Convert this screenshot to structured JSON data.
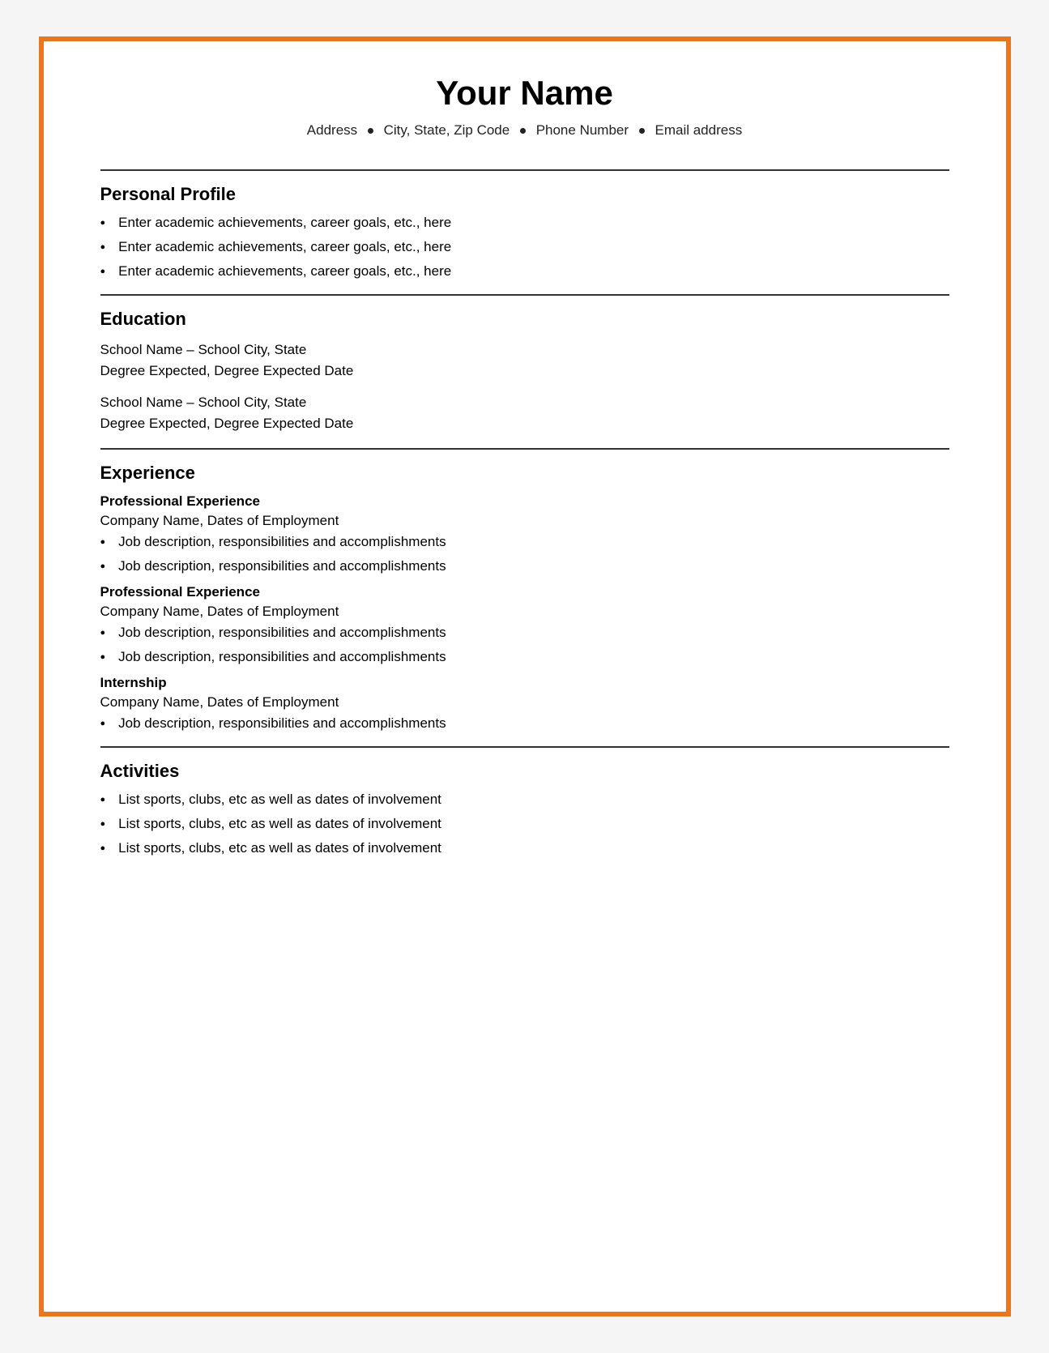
{
  "header": {
    "name": "Your Name",
    "address": "Address",
    "city": "City, State, Zip Code",
    "phone": "Phone Number",
    "email": "Email address"
  },
  "sections": {
    "personal_profile": {
      "title": "Personal Profile",
      "bullets": [
        "Enter academic achievements, career goals, etc., here",
        "Enter academic achievements, career goals, etc., here",
        "Enter academic achievements, career goals, etc., here"
      ]
    },
    "education": {
      "title": "Education",
      "entries": [
        {
          "school": "School Name – School City, State",
          "degree": "Degree Expected, Degree Expected Date"
        },
        {
          "school": "School Name – School City, State",
          "degree": "Degree Expected, Degree Expected Date"
        }
      ]
    },
    "experience": {
      "title": "Experience",
      "jobs": [
        {
          "subtitle": "Professional Experience",
          "company": "Company Name, Dates of Employment",
          "bullets": [
            "Job description, responsibilities and accomplishments",
            "Job description, responsibilities and accomplishments"
          ]
        },
        {
          "subtitle": "Professional Experience",
          "company": "Company Name, Dates of Employment",
          "bullets": [
            "Job description, responsibilities and accomplishments",
            "Job description, responsibilities and accomplishments"
          ]
        },
        {
          "subtitle": "Internship",
          "company": "Company Name, Dates of Employment",
          "bullets": [
            "Job description, responsibilities and accomplishments"
          ]
        }
      ]
    },
    "activities": {
      "title": "Activities",
      "bullets": [
        "List sports, clubs, etc as well as dates of involvement",
        "List sports, clubs, etc as well as dates of involvement",
        "List sports, clubs, etc as well as dates of involvement"
      ]
    }
  }
}
